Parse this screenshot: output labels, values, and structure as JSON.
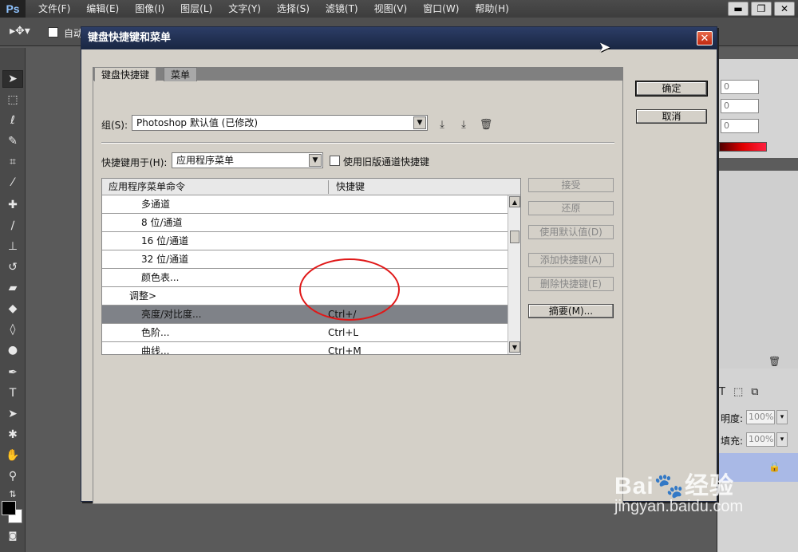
{
  "app": {
    "logo": "Ps",
    "menus": [
      "文件(F)",
      "编辑(E)",
      "图像(I)",
      "图层(L)",
      "文字(Y)",
      "选择(S)",
      "滤镜(T)",
      "视图(V)",
      "窗口(W)",
      "帮助(H)"
    ],
    "window_controls": [
      "▬",
      "❐",
      "✕"
    ]
  },
  "options_bar": {
    "auto_select_label": "自动"
  },
  "toolbar": {
    "tools": [
      "move-tool",
      "marquee-tool",
      "lasso-tool",
      "quick-select-tool",
      "crop-tool",
      "eyedropper-tool",
      "healing-tool",
      "brush-tool",
      "stamp-tool",
      "history-brush-tool",
      "eraser-tool",
      "paint-bucket-tool",
      "blur-tool",
      "dodge-tool",
      "pen-tool",
      "type-tool",
      "path-select-tool",
      "shape-tool",
      "hand-tool",
      "zoom-tool"
    ]
  },
  "right_panels": {
    "fields": [
      "0",
      "0",
      "0"
    ],
    "opacity_label": "明度:",
    "opacity_value": "100%",
    "fill_label": "填充:",
    "fill_value": "100%"
  },
  "dialog": {
    "title": "键盘快捷键和菜单",
    "close_glyph": "✕",
    "tabs": [
      "键盘快捷键",
      "菜单"
    ],
    "group_label": "组(S):",
    "group_value": "Photoshop 默认值 (已修改)",
    "shortcuts_for_label": "快捷键用于(H):",
    "shortcuts_for_value": "应用程序菜单",
    "legacy_checkbox_label": "使用旧版通道快捷键",
    "table": {
      "columns": [
        "应用程序菜单命令",
        "快捷键"
      ],
      "rows": [
        {
          "command": "多通道",
          "shortcut": "",
          "indent": 2
        },
        {
          "command": "8 位/通道",
          "shortcut": "",
          "indent": 2
        },
        {
          "command": "16 位/通道",
          "shortcut": "",
          "indent": 2
        },
        {
          "command": "32 位/通道",
          "shortcut": "",
          "indent": 2
        },
        {
          "command": "颜色表...",
          "shortcut": "",
          "indent": 2
        },
        {
          "command": "调整>",
          "shortcut": "",
          "indent": 1
        },
        {
          "command": "亮度/对比度...",
          "shortcut": "Ctrl+/",
          "indent": 2,
          "selected": true
        },
        {
          "command": "色阶...",
          "shortcut": "Ctrl+L",
          "indent": 2
        },
        {
          "command": "曲线...",
          "shortcut": "Ctrl+M",
          "indent": 2
        }
      ]
    },
    "side_buttons": {
      "accept": "接受",
      "undo": "还原",
      "use_default": "使用默认值(D)",
      "add_shortcut": "添加快捷键(A)",
      "delete_shortcut": "删除快捷键(E)",
      "summarize": "摘要(M)..."
    },
    "ok": "确定",
    "cancel": "取消"
  },
  "watermark": {
    "brand": "Bai🐾经验",
    "url": "jingyan.baidu.com"
  },
  "colors": {
    "title_bar": "#1f2f55",
    "close_button": "#d9401e",
    "selected_row": "#7f8288",
    "annotation": "#e01818"
  }
}
